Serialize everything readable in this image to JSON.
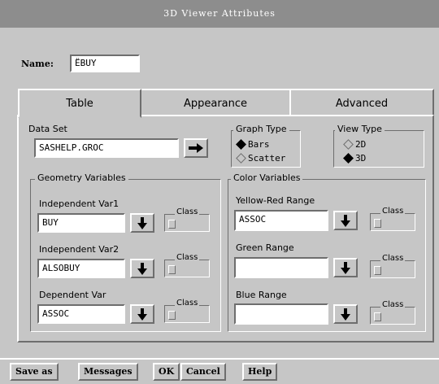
{
  "window": {
    "title": "3D Viewer Attributes"
  },
  "name": {
    "label": "Name:",
    "value": "ЁBUY"
  },
  "tabs": [
    {
      "label": "Table",
      "active": true
    },
    {
      "label": "Appearance",
      "active": false
    },
    {
      "label": "Advanced",
      "active": false
    }
  ],
  "data_set": {
    "label": "Data Set",
    "value": "SASHELP.GROC"
  },
  "graph_type": {
    "title": "Graph Type",
    "options": [
      "Bars",
      "Scatter"
    ],
    "selected": "Bars"
  },
  "view_type": {
    "title": "View Type",
    "options": [
      "2D",
      "3D"
    ],
    "selected": "3D"
  },
  "geometry": {
    "title": "Geometry Variables",
    "fields": [
      {
        "label": "Independent Var1",
        "value": "BUY",
        "class_label": "Class"
      },
      {
        "label": "Independent Var2",
        "value": "ALSOBUY",
        "class_label": "Class"
      },
      {
        "label": "Dependent Var",
        "value": "ASSOC",
        "class_label": "Class"
      }
    ]
  },
  "color": {
    "title": "Color Variables",
    "fields": [
      {
        "label": "Yellow-Red Range",
        "value": "ASSOC",
        "class_label": "Class"
      },
      {
        "label": "Green Range",
        "value": "",
        "class_label": "Class"
      },
      {
        "label": "Blue Range",
        "value": "",
        "class_label": "Class"
      }
    ]
  },
  "buttons": {
    "save_as": "Save as",
    "messages": "Messages",
    "ok": "OK",
    "cancel": "Cancel",
    "help": "Help"
  },
  "colors": {
    "background": "#c6c6c6",
    "titlebar": "#8d8d8d"
  },
  "icons": {
    "arrow": "right-arrow-icon",
    "pick": "down-arrow-icon"
  }
}
